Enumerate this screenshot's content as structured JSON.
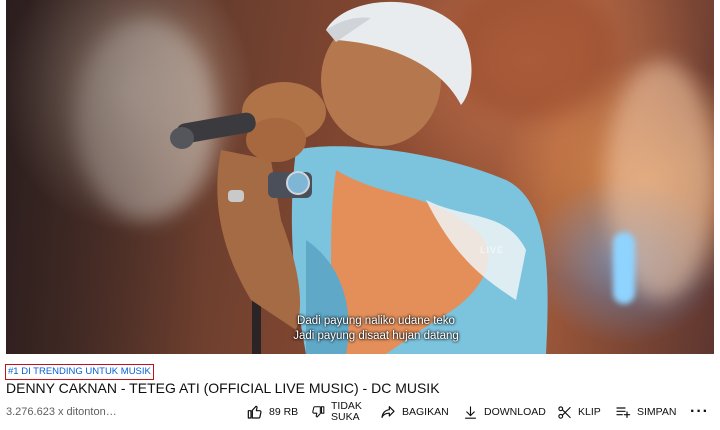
{
  "video": {
    "subtitle_line1": "Dadi payung naliko udane teko",
    "subtitle_line2": "Jadi payung disaat hujan datang",
    "watermark": "LIVE"
  },
  "meta": {
    "trending_tag": "#1 DI TRENDING UNTUK MUSIK",
    "title": "DENNY CAKNAN - TETEG ATI (OFFICIAL LIVE MUSIC) - DC MUSIK",
    "views": "3.276.623 x ditonton…"
  },
  "actions": {
    "like_count": "89 RB",
    "dislike_label": "TIDAK SUKA",
    "share_label": "BAGIKAN",
    "download_label": "DOWNLOAD",
    "clip_label": "KLIP",
    "save_label": "SIMPAN",
    "more_label": "···"
  },
  "colors": {
    "trending_link": "#065fd4",
    "trending_border": "#c0101a",
    "secondary_text": "#606060"
  }
}
